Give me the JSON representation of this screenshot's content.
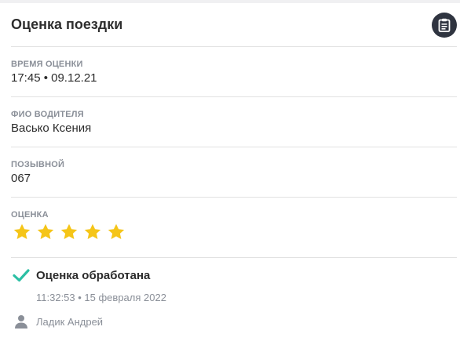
{
  "card": {
    "title": "Оценка поездки",
    "clipboard_icon": "clipboard-icon"
  },
  "fields": {
    "time_label": "ВРЕМЯ ОЦЕНКИ",
    "time_value": "17:45 • 09.12.21",
    "driver_label": "ФИО ВОДИТЕЛЯ",
    "driver_value": "Васько Ксения",
    "callsign_label": "ПОЗЫВНОЙ",
    "callsign_value": "067",
    "rating_label": "ОЦЕНКА",
    "rating_stars": 5,
    "rating_max": 5
  },
  "status": {
    "check_icon": "check-icon",
    "title": "Оценка обработана",
    "timestamp": "11:32:53 • 15 февраля 2022",
    "user_icon": "person-icon",
    "user_name": "Ладик Андрей"
  },
  "colors": {
    "star": "#f5c518",
    "check": "#2bbfa4",
    "button_bg": "#2f3440",
    "label": "#8a8f98"
  }
}
